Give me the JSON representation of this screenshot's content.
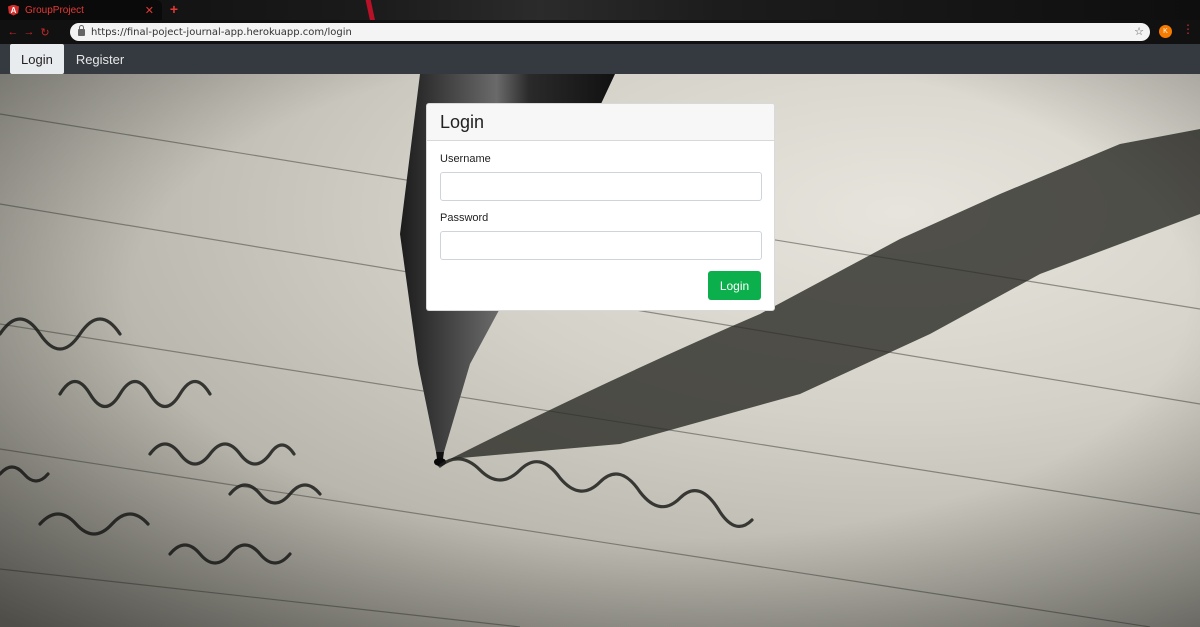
{
  "browser": {
    "tab_title": "GroupProject",
    "tab_close": "✕",
    "new_tab": "+",
    "url": "https://final-poject-journal-app.herokuapp.com/login",
    "avatar_initial": "K"
  },
  "navbar": {
    "items": [
      {
        "label": "Login",
        "active": true
      },
      {
        "label": "Register",
        "active": false
      }
    ]
  },
  "login_card": {
    "title": "Login",
    "username_label": "Username",
    "username_value": "",
    "password_label": "Password",
    "password_value": "",
    "submit_label": "Login"
  },
  "colors": {
    "navbar_bg": "#343a40",
    "submit_button": "#0bb04c",
    "tab_accent": "#e53935"
  }
}
